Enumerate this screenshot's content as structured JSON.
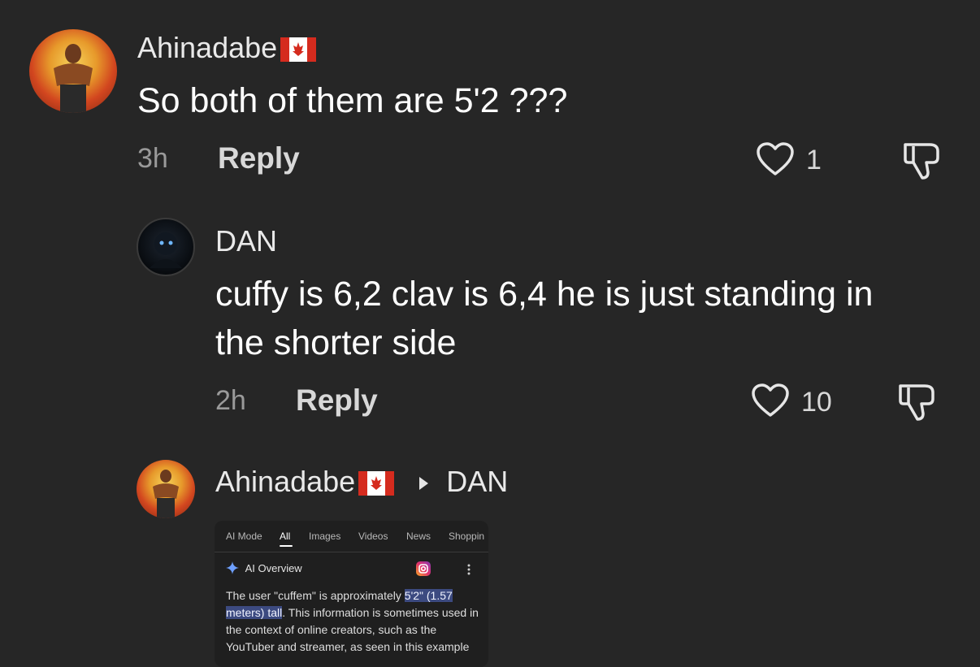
{
  "comments": [
    {
      "author": "Ahinadabe",
      "text": "So both of them are 5'2 ???",
      "time": "3h",
      "reply_label": "Reply",
      "likes": "1"
    },
    {
      "author": "DAN",
      "text_line1": "cuffy is 6,2 clav is 6,4 he is just standing in",
      "text_line2": "the shorter side",
      "time": "2h",
      "reply_label": "Reply",
      "likes": "10"
    },
    {
      "author": "Ahinadabe",
      "reply_to": "DAN",
      "image": {
        "tabs": [
          "AI Mode",
          "All",
          "Images",
          "Videos",
          "News",
          "Shoppin"
        ],
        "active_tab": "All",
        "ai_title": "AI Overview",
        "body_before": "The user \"cuffem\" is approximately ",
        "body_highlight1": "5'2\" (1.57",
        "body_highlight2": "meters) tall",
        "body_after": ". This information is sometimes used in the context of online creators, such as the YouTuber and streamer, as seen in this example"
      }
    }
  ],
  "colors": {
    "background": "#262626",
    "highlight": "#3c4a80"
  },
  "icons": [
    "canada-flag-icon",
    "heart-icon",
    "dislike-icon",
    "triangle-right-icon",
    "sparkle-icon",
    "instagram-icon",
    "kebab-menu-icon"
  ]
}
